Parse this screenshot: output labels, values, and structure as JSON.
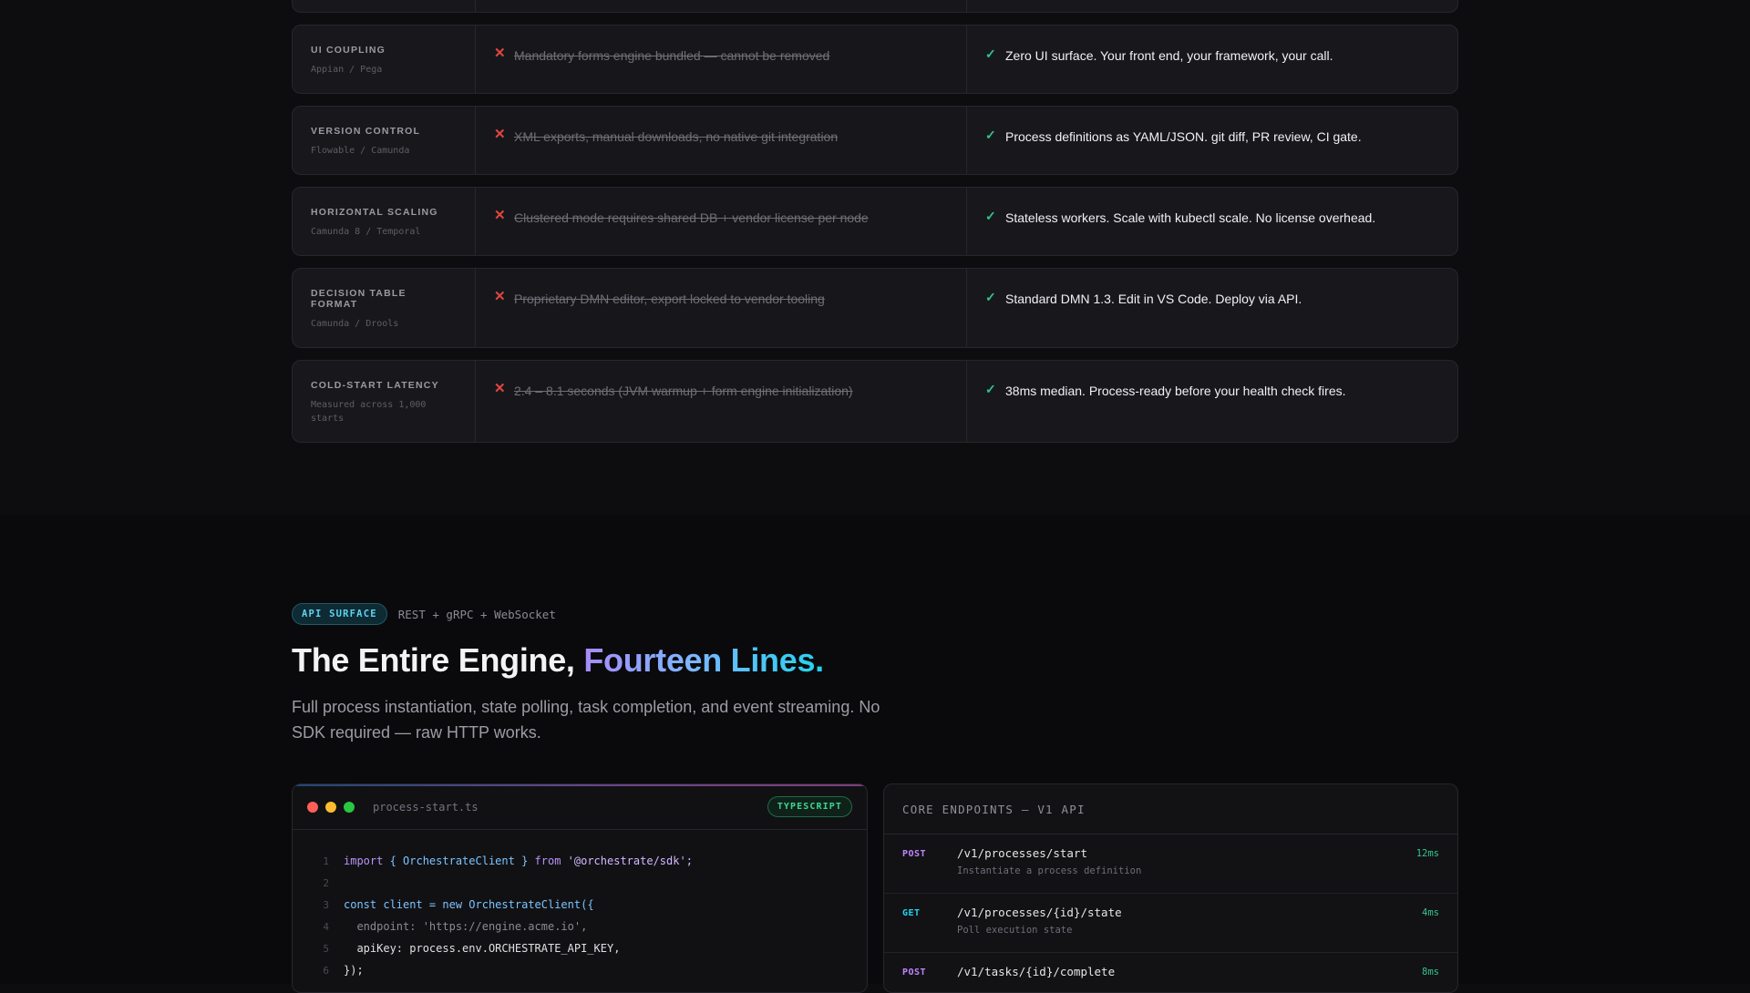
{
  "comparison": [
    {
      "label": "UI COUPLING",
      "sub": "Appian / Pega",
      "old": "Mandatory forms engine bundled — cannot be removed",
      "new": "Zero UI surface. Your front end, your framework, your call."
    },
    {
      "label": "VERSION CONTROL",
      "sub": "Flowable / Camunda",
      "old": "XML exports, manual downloads, no native git integration",
      "new": "Process definitions as YAML/JSON. git diff, PR review, CI gate."
    },
    {
      "label": "HORIZONTAL SCALING",
      "sub": "Camunda 8 / Temporal",
      "old": "Clustered mode requires shared DB + vendor license per node",
      "new": "Stateless workers. Scale with kubectl scale. No license overhead."
    },
    {
      "label": "DECISION TABLE FORMAT",
      "sub": "Camunda / Drools",
      "old": "Proprietary DMN editor, export locked to vendor tooling",
      "new": "Standard DMN 1.3. Edit in VS Code. Deploy via API."
    },
    {
      "label": "COLD-START LATENCY",
      "sub": "Measured across 1,000 starts",
      "old": "2.4 – 8.1 seconds (JVM warmup + form engine initialization)",
      "new": "38ms median. Process-ready before your health check fires."
    }
  ],
  "icons": {
    "fail": "✕",
    "ok": "✓"
  },
  "api": {
    "pill": "API SURFACE",
    "meta": "REST + gRPC + WebSocket",
    "title_a": "The Entire Engine, ",
    "title_b": "Fourteen Lines.",
    "desc": "Full process instantiation, state polling, task completion, and event streaming. No SDK required — raw HTTP works."
  },
  "code": {
    "filename": "process-start.ts",
    "lang": "TYPESCRIPT",
    "line_numbers": [
      "1",
      "2",
      "3",
      "4",
      "5",
      "6"
    ],
    "l1_kw": "import",
    "l1_mid": " { OrchestrateClient } ",
    "l1_from": "from",
    "l1_str": " '@orchestrate/sdk';",
    "l3_kw": "const",
    "l3_var": " client = ",
    "l3_new": "new",
    "l3_cls": " OrchestrateClient({",
    "l4": "  endpoint: 'https://engine.acme.io',",
    "l5": "  apiKey: process.env.ORCHESTRATE_API_KEY,",
    "l6": "});"
  },
  "endpoints": {
    "header": "CORE ENDPOINTS — V1 API",
    "items": [
      {
        "method": "POST",
        "path": "/v1/processes/start",
        "desc": "Instantiate a process definition",
        "latency": "12ms"
      },
      {
        "method": "GET",
        "path": "/v1/processes/{id}/state",
        "desc": "Poll execution state",
        "latency": "4ms"
      },
      {
        "method": "POST",
        "path": "/v1/tasks/{id}/complete",
        "desc": "",
        "latency": "8ms"
      }
    ]
  }
}
